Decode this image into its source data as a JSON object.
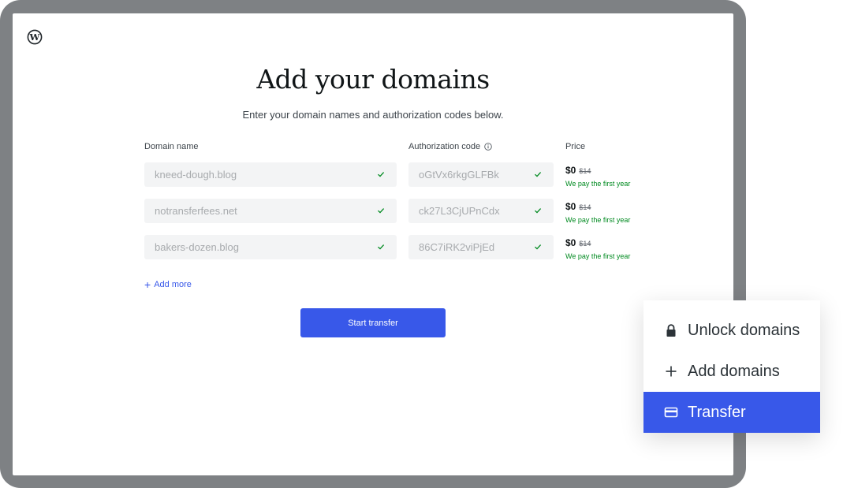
{
  "page": {
    "title": "Add your domains",
    "subtitle": "Enter your domain names and authorization codes below."
  },
  "columns": {
    "domain": "Domain name",
    "auth": "Authorization code",
    "price": "Price"
  },
  "rows": [
    {
      "domain": "kneed-dough.blog",
      "auth": "oGtVx6rkgGLFBk",
      "price": "$0",
      "old_price": "$14",
      "note": "We pay the first year"
    },
    {
      "domain": "notransferfees.net",
      "auth": "ck27L3CjUPnCdx",
      "price": "$0",
      "old_price": "$14",
      "note": "We pay the first year"
    },
    {
      "domain": "bakers-dozen.blog",
      "auth": "86C7iRK2viPjEd",
      "price": "$0",
      "old_price": "$14",
      "note": "We pay the first year"
    }
  ],
  "actions": {
    "add_more": "Add more",
    "start_transfer": "Start transfer"
  },
  "menu": {
    "items": [
      {
        "label": "Unlock domains",
        "icon": "lock-icon",
        "active": false
      },
      {
        "label": "Add domains",
        "icon": "plus-icon",
        "active": false
      },
      {
        "label": "Transfer",
        "icon": "card-icon",
        "active": true
      }
    ]
  },
  "colors": {
    "accent": "#3858e9",
    "success": "#008a20",
    "frame": "#7e8184"
  }
}
